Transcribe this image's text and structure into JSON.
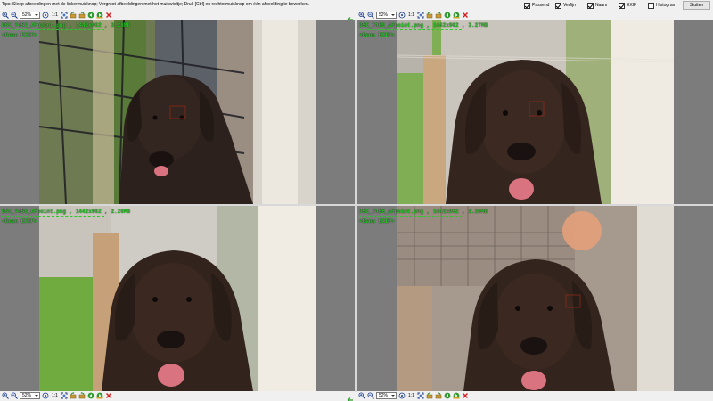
{
  "topbar": {
    "tip": "Tips: Sleep afbeeldingen met de linkermuisknop; Vergroot afbeeldingen met het muiswieltje; Druk [Ctrl] en rechtermuisknop om één afbeelding te bewerken.",
    "checkboxes": [
      {
        "label": "Passend",
        "checked": true
      },
      {
        "label": "Verfijn",
        "checked": true
      },
      {
        "label": "Naam",
        "checked": true
      },
      {
        "label": "EXIF",
        "checked": true
      },
      {
        "label": "Histogram",
        "checked": false
      }
    ],
    "close_label": "Sluiten"
  },
  "toolbar": {
    "zoom": "52%",
    "ratio": "1:1"
  },
  "panes": [
    {
      "filename": "DSC_7452_AFpoint.png",
      "dims": "1442x962",
      "size": "3.28MB",
      "exif": "<Geen EXIF>"
    },
    {
      "filename": "DSC_7460_AFpoint.png",
      "dims": "1442x962",
      "size": "3.27MB",
      "exif": "<Geen EXIF>"
    },
    {
      "filename": "DSC_7458_AFpoint.png",
      "dims": "1442x962",
      "size": "2.26MB",
      "exif": "<Geen EXIF>"
    },
    {
      "filename": "DSC_7456_AFpoint.png",
      "dims": "1442x962",
      "size": "2.20MB",
      "exif": "<Geen EXIF>"
    }
  ],
  "colors": {
    "overlay_text": "#22cc22",
    "af_point": "#8b2a1a",
    "pane_bg": "#7c7c7c"
  },
  "icons": [
    "zoom-in-icon",
    "zoom-out-icon",
    "fit-icon",
    "actual-size-icon",
    "fullscreen-icon",
    "rotate-left-icon",
    "rotate-right-icon",
    "prev-image-icon",
    "next-image-icon",
    "close-image-icon",
    "sync-arrow-icon"
  ]
}
